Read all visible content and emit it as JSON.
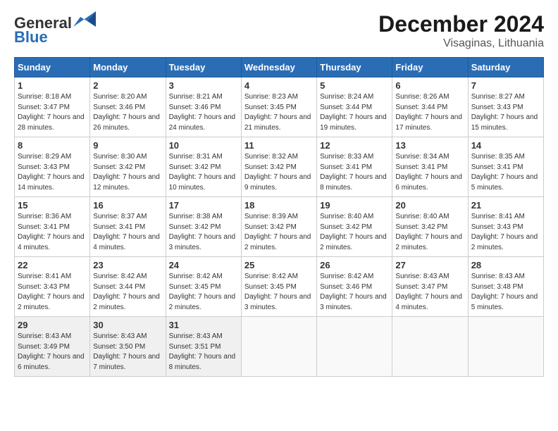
{
  "logo": {
    "blue": "Blue"
  },
  "header": {
    "title": "December 2024",
    "location": "Visaginas, Lithuania"
  },
  "days": [
    "Sunday",
    "Monday",
    "Tuesday",
    "Wednesday",
    "Thursday",
    "Friday",
    "Saturday"
  ],
  "weeks": [
    [
      {
        "day": "1",
        "sunrise": "Sunrise: 8:18 AM",
        "sunset": "Sunset: 3:47 PM",
        "daylight": "Daylight: 7 hours and 28 minutes."
      },
      {
        "day": "2",
        "sunrise": "Sunrise: 8:20 AM",
        "sunset": "Sunset: 3:46 PM",
        "daylight": "Daylight: 7 hours and 26 minutes."
      },
      {
        "day": "3",
        "sunrise": "Sunrise: 8:21 AM",
        "sunset": "Sunset: 3:46 PM",
        "daylight": "Daylight: 7 hours and 24 minutes."
      },
      {
        "day": "4",
        "sunrise": "Sunrise: 8:23 AM",
        "sunset": "Sunset: 3:45 PM",
        "daylight": "Daylight: 7 hours and 21 minutes."
      },
      {
        "day": "5",
        "sunrise": "Sunrise: 8:24 AM",
        "sunset": "Sunset: 3:44 PM",
        "daylight": "Daylight: 7 hours and 19 minutes."
      },
      {
        "day": "6",
        "sunrise": "Sunrise: 8:26 AM",
        "sunset": "Sunset: 3:44 PM",
        "daylight": "Daylight: 7 hours and 17 minutes."
      },
      {
        "day": "7",
        "sunrise": "Sunrise: 8:27 AM",
        "sunset": "Sunset: 3:43 PM",
        "daylight": "Daylight: 7 hours and 15 minutes."
      }
    ],
    [
      {
        "day": "8",
        "sunrise": "Sunrise: 8:29 AM",
        "sunset": "Sunset: 3:43 PM",
        "daylight": "Daylight: 7 hours and 14 minutes."
      },
      {
        "day": "9",
        "sunrise": "Sunrise: 8:30 AM",
        "sunset": "Sunset: 3:42 PM",
        "daylight": "Daylight: 7 hours and 12 minutes."
      },
      {
        "day": "10",
        "sunrise": "Sunrise: 8:31 AM",
        "sunset": "Sunset: 3:42 PM",
        "daylight": "Daylight: 7 hours and 10 minutes."
      },
      {
        "day": "11",
        "sunrise": "Sunrise: 8:32 AM",
        "sunset": "Sunset: 3:42 PM",
        "daylight": "Daylight: 7 hours and 9 minutes."
      },
      {
        "day": "12",
        "sunrise": "Sunrise: 8:33 AM",
        "sunset": "Sunset: 3:41 PM",
        "daylight": "Daylight: 7 hours and 8 minutes."
      },
      {
        "day": "13",
        "sunrise": "Sunrise: 8:34 AM",
        "sunset": "Sunset: 3:41 PM",
        "daylight": "Daylight: 7 hours and 6 minutes."
      },
      {
        "day": "14",
        "sunrise": "Sunrise: 8:35 AM",
        "sunset": "Sunset: 3:41 PM",
        "daylight": "Daylight: 7 hours and 5 minutes."
      }
    ],
    [
      {
        "day": "15",
        "sunrise": "Sunrise: 8:36 AM",
        "sunset": "Sunset: 3:41 PM",
        "daylight": "Daylight: 7 hours and 4 minutes."
      },
      {
        "day": "16",
        "sunrise": "Sunrise: 8:37 AM",
        "sunset": "Sunset: 3:41 PM",
        "daylight": "Daylight: 7 hours and 4 minutes."
      },
      {
        "day": "17",
        "sunrise": "Sunrise: 8:38 AM",
        "sunset": "Sunset: 3:42 PM",
        "daylight": "Daylight: 7 hours and 3 minutes."
      },
      {
        "day": "18",
        "sunrise": "Sunrise: 8:39 AM",
        "sunset": "Sunset: 3:42 PM",
        "daylight": "Daylight: 7 hours and 2 minutes."
      },
      {
        "day": "19",
        "sunrise": "Sunrise: 8:40 AM",
        "sunset": "Sunset: 3:42 PM",
        "daylight": "Daylight: 7 hours and 2 minutes."
      },
      {
        "day": "20",
        "sunrise": "Sunrise: 8:40 AM",
        "sunset": "Sunset: 3:42 PM",
        "daylight": "Daylight: 7 hours and 2 minutes."
      },
      {
        "day": "21",
        "sunrise": "Sunrise: 8:41 AM",
        "sunset": "Sunset: 3:43 PM",
        "daylight": "Daylight: 7 hours and 2 minutes."
      }
    ],
    [
      {
        "day": "22",
        "sunrise": "Sunrise: 8:41 AM",
        "sunset": "Sunset: 3:43 PM",
        "daylight": "Daylight: 7 hours and 2 minutes."
      },
      {
        "day": "23",
        "sunrise": "Sunrise: 8:42 AM",
        "sunset": "Sunset: 3:44 PM",
        "daylight": "Daylight: 7 hours and 2 minutes."
      },
      {
        "day": "24",
        "sunrise": "Sunrise: 8:42 AM",
        "sunset": "Sunset: 3:45 PM",
        "daylight": "Daylight: 7 hours and 2 minutes."
      },
      {
        "day": "25",
        "sunrise": "Sunrise: 8:42 AM",
        "sunset": "Sunset: 3:45 PM",
        "daylight": "Daylight: 7 hours and 3 minutes."
      },
      {
        "day": "26",
        "sunrise": "Sunrise: 8:42 AM",
        "sunset": "Sunset: 3:46 PM",
        "daylight": "Daylight: 7 hours and 3 minutes."
      },
      {
        "day": "27",
        "sunrise": "Sunrise: 8:43 AM",
        "sunset": "Sunset: 3:47 PM",
        "daylight": "Daylight: 7 hours and 4 minutes."
      },
      {
        "day": "28",
        "sunrise": "Sunrise: 8:43 AM",
        "sunset": "Sunset: 3:48 PM",
        "daylight": "Daylight: 7 hours and 5 minutes."
      }
    ],
    [
      {
        "day": "29",
        "sunrise": "Sunrise: 8:43 AM",
        "sunset": "Sunset: 3:49 PM",
        "daylight": "Daylight: 7 hours and 6 minutes."
      },
      {
        "day": "30",
        "sunrise": "Sunrise: 8:43 AM",
        "sunset": "Sunset: 3:50 PM",
        "daylight": "Daylight: 7 hours and 7 minutes."
      },
      {
        "day": "31",
        "sunrise": "Sunrise: 8:43 AM",
        "sunset": "Sunset: 3:51 PM",
        "daylight": "Daylight: 7 hours and 8 minutes."
      },
      null,
      null,
      null,
      null
    ]
  ]
}
